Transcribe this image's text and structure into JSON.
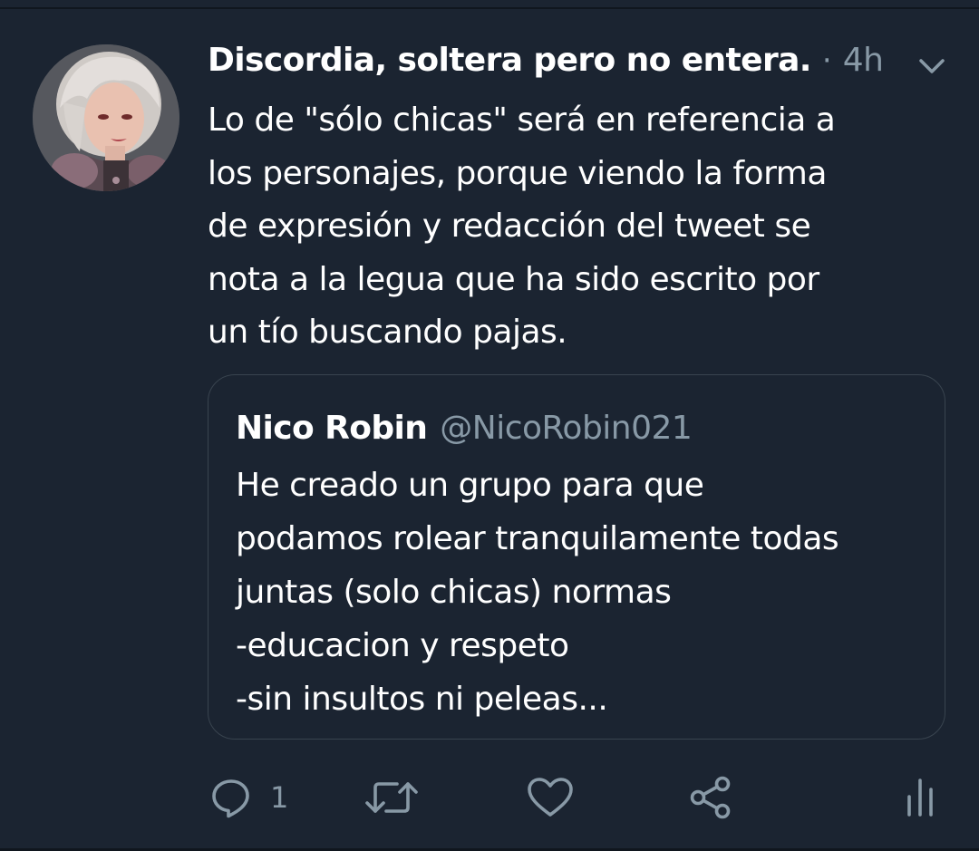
{
  "tweet": {
    "author_name": "Discordia, soltera pero no entera.",
    "separator": "·",
    "timestamp": "4h",
    "text_lines": [
      "Lo de \"sólo chicas\" será en referencia a",
      "los personajes, porque viendo la forma",
      "de expresión y redacción del tweet se",
      "nota a la legua que ha sido escrito por",
      "un tío buscando pajas."
    ]
  },
  "quoted_tweet": {
    "name": "Nico Robin",
    "handle": "@NicoRobin021",
    "text_lines": [
      "He creado un grupo para que",
      "podamos rolear tranquilamente todas",
      "juntas (solo chicas) normas",
      "-educacion y respeto",
      "-sin insultos ni peleas..."
    ]
  },
  "actions": {
    "reply_count": "1",
    "icons": [
      "reply-icon",
      "retweet-icon",
      "like-icon",
      "share-icon",
      "analytics-icon"
    ]
  },
  "colors": {
    "background": "#1b2431",
    "text_primary": "#ffffff",
    "text_secondary": "#8899a6",
    "border": "#39444f"
  }
}
